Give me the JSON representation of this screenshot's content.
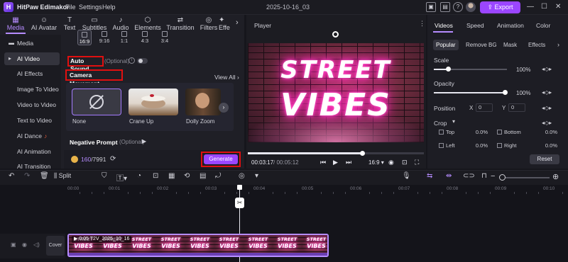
{
  "titlebar": {
    "app_name": "HitPaw Edimakor",
    "menus": [
      "File",
      "Settings",
      "Help"
    ],
    "project_title": "2025-10-16_03",
    "export_label": "Export"
  },
  "top_tabs": [
    {
      "label": "Media",
      "icon": "media-icon"
    },
    {
      "label": "AI Avatar",
      "icon": "ai-avatar-icon"
    },
    {
      "label": "Text",
      "icon": "text-icon"
    },
    {
      "label": "Subtitles",
      "icon": "subtitles-icon"
    },
    {
      "label": "Audio",
      "icon": "audio-icon"
    },
    {
      "label": "Elements",
      "icon": "elements-icon"
    },
    {
      "label": "Transition",
      "icon": "transition-icon"
    },
    {
      "label": "Filters",
      "icon": "filters-icon"
    },
    {
      "label": "Effe",
      "icon": "effects-icon"
    }
  ],
  "sidenav": [
    {
      "label": "Media"
    },
    {
      "label": "AI Video"
    },
    {
      "label": "AI Effects"
    },
    {
      "label": "Image To Video"
    },
    {
      "label": "Video to Video"
    },
    {
      "label": "Text to Video"
    },
    {
      "label": "AI Dance"
    },
    {
      "label": "AI Animation"
    },
    {
      "label": "AI Transition"
    }
  ],
  "aspect_ratios": [
    "16:9",
    "9:16",
    "1:1",
    "4:3",
    "3:4"
  ],
  "auto_sound": {
    "label": "Auto Sound",
    "optional": "(Optional)",
    "enabled": false
  },
  "camera_movement": {
    "label": "Camera Movement",
    "view_all": "View All",
    "options": [
      "None",
      "Crane Up",
      "Dolly Zoom"
    ],
    "selected": "None"
  },
  "negative_prompt": {
    "label": "Negative Prompt",
    "optional": "(Optional)"
  },
  "credits": {
    "used": "160",
    "total": "/7991"
  },
  "generate_label": "Generate",
  "player": {
    "title": "Player",
    "neon_line1": "STREET",
    "neon_line2": "VIBES",
    "current_time": "00:03:17",
    "total_time": "/ 00:05:12",
    "ratio": "16:9",
    "progress": 0.65
  },
  "right_panel": {
    "tabs": [
      "Videos",
      "Speed",
      "Animation",
      "Color"
    ],
    "subtabs": [
      "Popular",
      "Remove BG",
      "Mask",
      "Effects"
    ],
    "scale_label": "Scale",
    "scale_value": "100%",
    "opacity_label": "Opacity",
    "opacity_value": "100%",
    "position_label": "Position",
    "pos_x_label": "X",
    "pos_x": "0",
    "pos_y_label": "Y",
    "pos_y": "0",
    "crop_label": "Crop",
    "crop": [
      {
        "label": "Top",
        "value": "0.0%"
      },
      {
        "label": "Bottom",
        "value": "0.0%"
      },
      {
        "label": "Left",
        "value": "0.0%"
      },
      {
        "label": "Right",
        "value": "0.0%"
      }
    ],
    "reset_label": "Reset"
  },
  "toolbar": {
    "split_label": "Split"
  },
  "timeline": {
    "ticks": [
      "00:00",
      "00:01",
      "00:02",
      "00:03",
      "00:04",
      "00:05",
      "00:06",
      "00:07",
      "00:08",
      "00:09",
      "00:10"
    ],
    "cover_label": "Cover",
    "clip_label": "0:05  T2V_2025_10_16",
    "thumb_line1": "STREET",
    "thumb_line2": "VIBES"
  },
  "colors": {
    "accent": "#9b46ff",
    "highlight": "#e01010"
  }
}
